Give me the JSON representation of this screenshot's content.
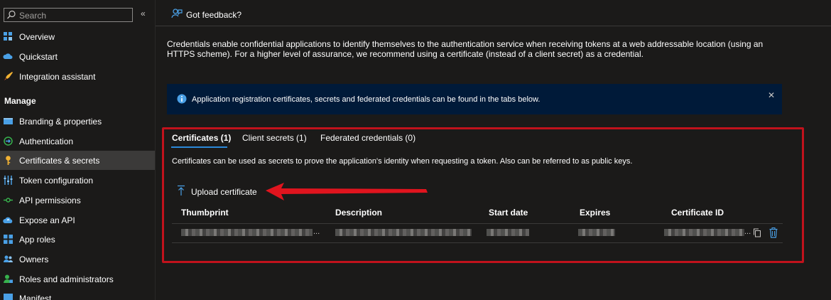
{
  "search": {
    "placeholder": "Search"
  },
  "sidebar": {
    "manage_header": "Manage",
    "items": [
      {
        "label": "Overview",
        "icon": "overview-icon"
      },
      {
        "label": "Quickstart",
        "icon": "cloud-icon"
      },
      {
        "label": "Integration assistant",
        "icon": "rocket-icon"
      },
      {
        "label": "Branding & properties",
        "icon": "branding-icon"
      },
      {
        "label": "Authentication",
        "icon": "authentication-icon"
      },
      {
        "label": "Certificates & secrets",
        "icon": "key-icon",
        "active": true
      },
      {
        "label": "Token configuration",
        "icon": "token-config-icon"
      },
      {
        "label": "API permissions",
        "icon": "api-permissions-icon"
      },
      {
        "label": "Expose an API",
        "icon": "expose-api-icon"
      },
      {
        "label": "App roles",
        "icon": "app-roles-icon"
      },
      {
        "label": "Owners",
        "icon": "owners-icon"
      },
      {
        "label": "Roles and administrators",
        "icon": "roles-admins-icon"
      },
      {
        "label": "Manifest",
        "icon": "manifest-icon"
      }
    ]
  },
  "header": {
    "feedback_label": "Got feedback?"
  },
  "intro_text": "Credentials enable confidential applications to identify themselves to the authentication service when receiving tokens at a web addressable location (using an HTTPS scheme). For a higher level of assurance, we recommend using a certificate (instead of a client secret) as a credential.",
  "info_bar": {
    "message": "Application registration certificates, secrets and federated credentials can be found in the tabs below.",
    "close": "✕"
  },
  "tabs": [
    {
      "label": "Certificates (1)",
      "active": true
    },
    {
      "label": "Client secrets (1)"
    },
    {
      "label": "Federated credentials (0)"
    }
  ],
  "certificates": {
    "description": "Certificates can be used as secrets to prove the application's identity when requesting a token. Also can be referred to as public keys.",
    "upload_label": "Upload certificate",
    "columns": [
      "Thumbprint",
      "Description",
      "Start date",
      "Expires",
      "Certificate ID"
    ],
    "ellipsis": "..."
  },
  "colors": {
    "accent": "#2b88d8",
    "highlight": "#c1121c",
    "info_bg": "#001a39"
  }
}
